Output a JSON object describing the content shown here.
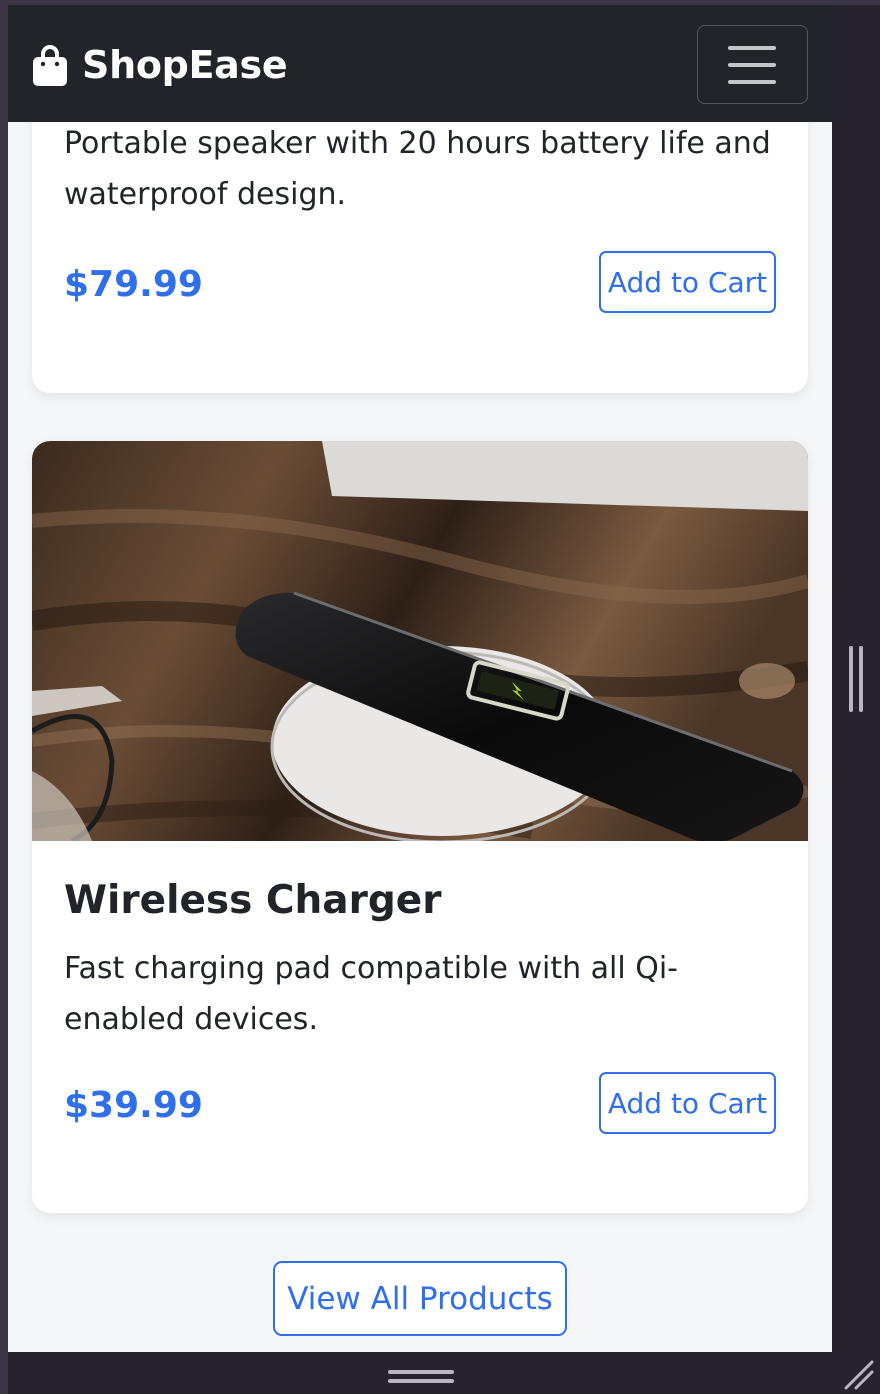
{
  "navbar": {
    "brand": "ShopEase",
    "brand_icon": "shopping-bag-icon",
    "toggler_icon": "hamburger-menu-icon",
    "background": "#212529"
  },
  "products": [
    {
      "description": "Portable speaker with 20 hours battery life and waterproof design.",
      "price": "$79.99",
      "button": "Add to Cart"
    },
    {
      "title": "Wireless Charger",
      "description": "Fast charging pad compatible with all Qi-enabled devices.",
      "price": "$39.99",
      "button": "Add to Cart",
      "image": "wireless-charger-photo"
    }
  ],
  "view_all_label": "View All Products",
  "colors": {
    "accent": "#2f6fec",
    "text": "#212529",
    "page_background": "#f5f6f8"
  }
}
